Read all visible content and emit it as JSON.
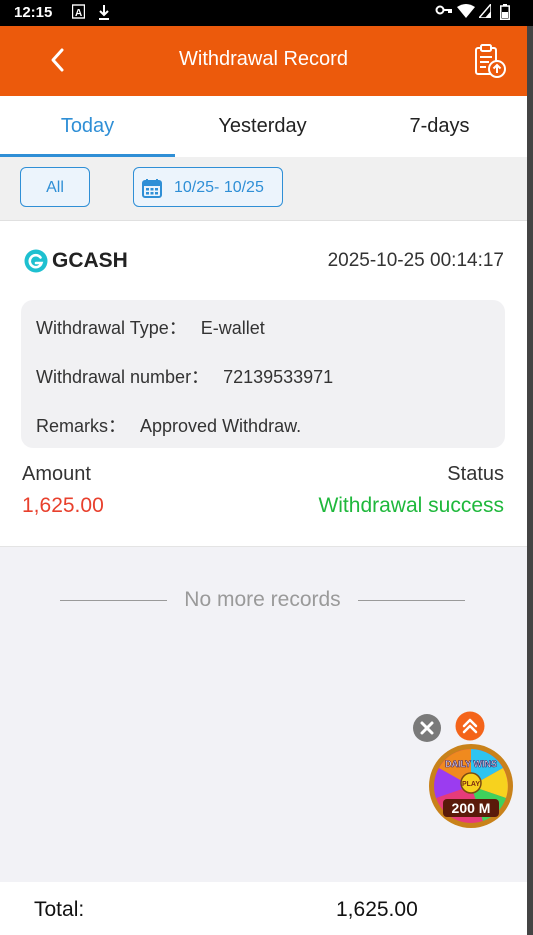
{
  "status_bar": {
    "time": "12:15",
    "icons": [
      "a-notification-icon",
      "download-icon",
      "vpn-key-icon",
      "wifi-icon",
      "signal-icon",
      "battery-icon"
    ]
  },
  "header": {
    "title": "Withdrawal Record",
    "back_icon": "chevron-left-icon",
    "action_icon": "clipboard-upload-icon"
  },
  "tabs": [
    {
      "label": "Today",
      "active": true
    },
    {
      "label": "Yesterday",
      "active": false
    },
    {
      "label": "7-days",
      "active": false
    }
  ],
  "filters": {
    "all_label": "All",
    "date_range": "10/25- 10/25",
    "calendar_icon": "calendar-icon"
  },
  "record": {
    "method": "GCASH",
    "datetime": "2025-10-25 00:14:17",
    "details": [
      {
        "key": "Withdrawal Type：",
        "value": "E-wallet"
      },
      {
        "key": "Withdrawal number：",
        "value": "72139533971"
      },
      {
        "key": "Remarks：",
        "value": "Approved Withdraw."
      }
    ],
    "amount_label": "Amount",
    "amount": "1,625.00",
    "status_label": "Status",
    "status": "Withdrawal success"
  },
  "list_end": "No more records",
  "promo": {
    "line1": "DAILY WINS",
    "play": "PLAY",
    "amount": "200 M"
  },
  "footer": {
    "total_label": "Total:",
    "total_value": "1,625.00"
  },
  "colors": {
    "header": "#ec5a0c",
    "accent": "#2f8fd6",
    "amount": "#e8402d",
    "success": "#1fb83c"
  }
}
